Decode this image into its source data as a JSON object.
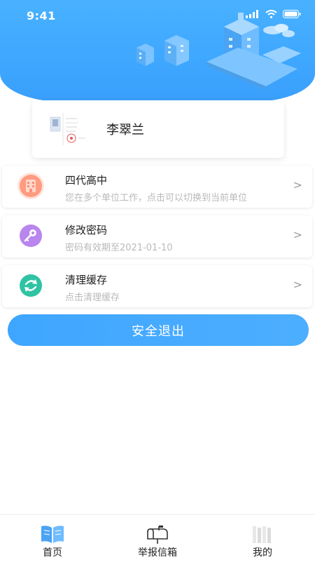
{
  "status_bar": {
    "time": "9:41"
  },
  "profile": {
    "name": "李翠兰"
  },
  "menu": [
    {
      "title": "四代高中",
      "subtitle": "您在多个单位工作，点击可以切换到当前单位",
      "icon": "building-icon",
      "color": "#ff8f73"
    },
    {
      "title": "修改密码",
      "subtitle": "密码有效期至2021-01-10",
      "icon": "key-icon",
      "color": "#b07ee8"
    },
    {
      "title": "清理缓存",
      "subtitle": "点击清理缓存",
      "icon": "refresh-icon",
      "color": "#2fc3a3"
    }
  ],
  "actions": {
    "logout": "安全退出"
  },
  "chevron": ">",
  "nav": [
    {
      "label": "首页",
      "icon": "book-icon"
    },
    {
      "label": "举报信箱",
      "icon": "mailbox-icon"
    },
    {
      "label": "我的",
      "icon": "person-icon"
    }
  ],
  "colors": {
    "primary": "#3ea7ff",
    "header": "#49b1ff"
  }
}
